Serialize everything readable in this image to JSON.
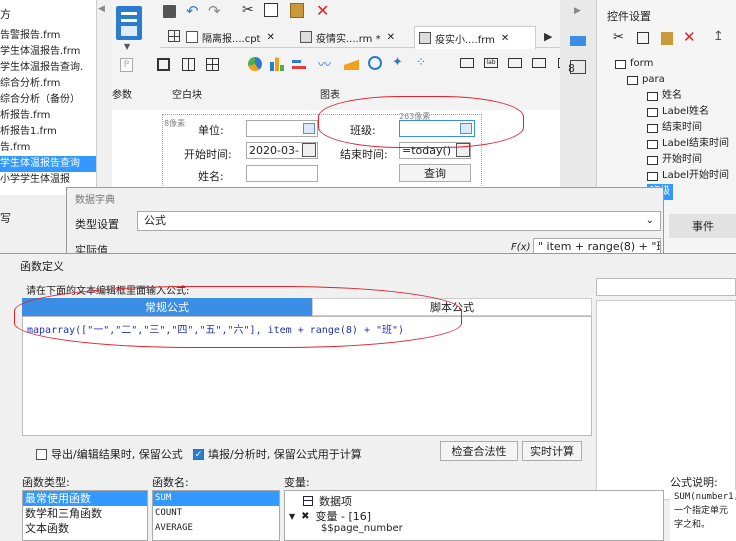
{
  "left_files": [
    "告警报告.frm",
    "学生体温报告.frm",
    "学生体温报告查询.",
    "综合分析.frm",
    "综合分析（备份）",
    "析报告.frm",
    "析报告1.frm",
    "告.frm",
    "学生体温报告查询",
    "小学学生体温报"
  ],
  "left_top_char": "方",
  "left_write": "写",
  "toolbar": {
    "tabs": [
      {
        "label": "隔离报....cpt"
      },
      {
        "label": "疫情实....rm *"
      },
      {
        "label": "疫实小....frm"
      }
    ],
    "groups": {
      "params": "参数",
      "blank": "空白块",
      "chart": "图表"
    }
  },
  "form": {
    "unit_label": "单位:",
    "class_label": "班级:",
    "start_label": "开始时间:",
    "start_value": "2020-03-",
    "end_label": "结束时间:",
    "end_value": "=today()",
    "name_label": "姓名:",
    "query_btn": "查询",
    "px_hint": "8像素",
    "size_hint": "263像素"
  },
  "right_panel": {
    "title": "控件设置",
    "tree": [
      "form",
      "para",
      "姓名",
      "Label姓名",
      "结束时间",
      "Label结束时间",
      "开始时间",
      "Label开始时间",
      "班级"
    ],
    "event_btn": "事件"
  },
  "dict_dialog": {
    "title": "数据字典",
    "type_label": "类型设置",
    "type_value": "公式",
    "actual_label": "实际值",
    "fx": "F(x)",
    "formula_preview": "\" item + range(8) + \"班\""
  },
  "func_dialog": {
    "title": "函数定义",
    "hint": "请在下面的文本编辑框里面输入公式:",
    "tab_normal": "常规公式",
    "tab_script": "脚本公式",
    "formula": "maparray([\"一\",\"二\",\"三\",\"四\",\"五\",\"六\"], item + range(8) + \"班\")",
    "chk_export": "导出/编辑结果时, 保留公式",
    "chk_fill": "填报/分析时, 保留公式用于计算",
    "check_btn": "检查合法性",
    "calc_btn": "实时计算",
    "func_type_label": "函数类型:",
    "func_name_label": "函数名:",
    "var_label": "变量:",
    "desc_label": "公式说明:",
    "func_types": [
      "最常使用函数",
      "数学和三角函数",
      "文本函数"
    ],
    "func_names": [
      "SUM",
      "COUNT",
      "AVERAGE"
    ],
    "vars": [
      "数据项",
      "变量 - [16]",
      "$$page_number"
    ],
    "desc": [
      "SUM(number1,",
      "一个指定单元",
      "字之和。"
    ]
  },
  "colors": {
    "accent": "#3a8ee6",
    "selected": "#3399ff",
    "red": "#e0202a"
  }
}
